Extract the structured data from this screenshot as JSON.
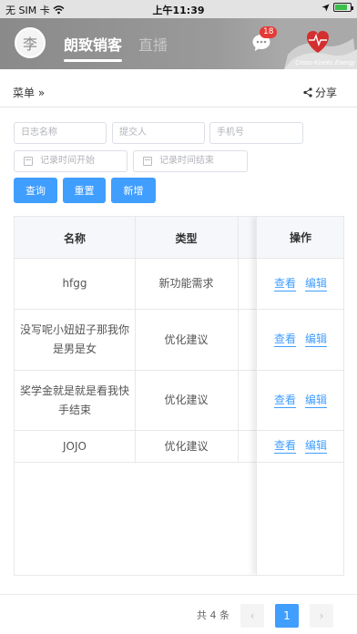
{
  "status_bar": {
    "carrier": "无 SIM 卡",
    "time": "上午11:39",
    "battery_level": 0.8
  },
  "header": {
    "avatar_text": "李",
    "tabs": [
      {
        "label": "朗致销客",
        "active": true
      },
      {
        "label": "直播",
        "active": false
      }
    ],
    "message_badge": "18",
    "brand_text": "Cross-Kinetic Energy",
    "icons": [
      "chat-bubble-icon",
      "heart-hands-icon"
    ]
  },
  "menu": {
    "menu_label": "菜单 »",
    "share_label": "分享"
  },
  "filters": {
    "log_name_placeholder": "日志名称",
    "submitter_placeholder": "提交人",
    "phone_placeholder": "手机号",
    "start_time_placeholder": "记录时间开始",
    "end_time_placeholder": "记录时间结束"
  },
  "buttons": {
    "query": "查询",
    "reset": "重置",
    "add": "新增"
  },
  "table": {
    "headers": {
      "name": "名称",
      "type": "类型",
      "action": "操作"
    },
    "rows": [
      {
        "name": "hfgg",
        "type": "新功能需求",
        "view": "查看",
        "edit": "编辑"
      },
      {
        "name": "没写呢小妞妞子那我你是男是女",
        "type": "优化建议",
        "view": "查看",
        "edit": "编辑"
      },
      {
        "name": "奖学金就是就是看我快手结束",
        "type": "优化建议",
        "view": "查看",
        "edit": "编辑"
      },
      {
        "name": "JOJO",
        "type": "优化建议",
        "view": "查看",
        "edit": "编辑"
      }
    ]
  },
  "pagination": {
    "total_label": "共 4 条",
    "prev": "‹",
    "current": "1",
    "next": "›"
  },
  "colors": {
    "primary": "#409eff",
    "badge": "#e53935",
    "header_bg": "#8f8f8f"
  }
}
